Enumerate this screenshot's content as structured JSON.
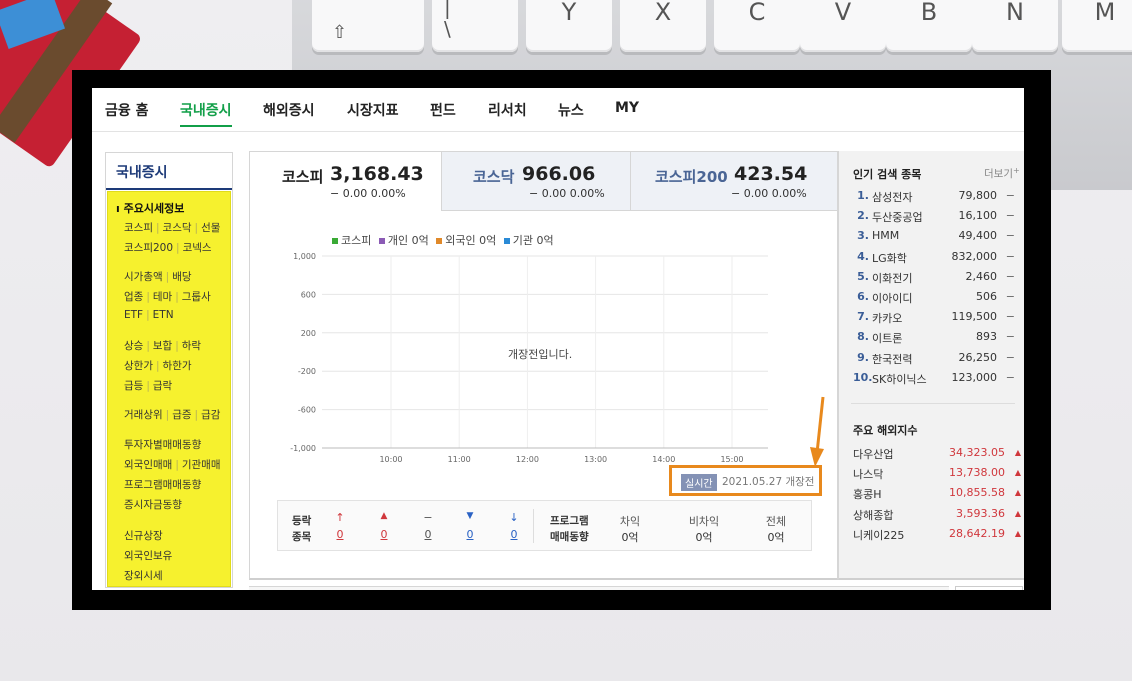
{
  "nav": {
    "tabs": [
      {
        "label": "금융 홈"
      },
      {
        "label": "국내증시"
      },
      {
        "label": "해외증시"
      },
      {
        "label": "시장지표"
      },
      {
        "label": "펀드"
      },
      {
        "label": "리서치"
      },
      {
        "label": "뉴스"
      },
      {
        "label": "MY"
      }
    ],
    "active_tab": "국내증시"
  },
  "sidebar": {
    "title": "국내증시",
    "section_head": "주요시세정보",
    "rows": [
      [
        "코스피",
        "코스닥",
        "선물"
      ],
      [
        "코스피200",
        "코넥스"
      ],
      [
        "시가총액",
        "배당"
      ],
      [
        "업종",
        "테마",
        "그룹사"
      ],
      [
        "ETF",
        "ETN"
      ],
      [
        "상승",
        "보합",
        "하락"
      ],
      [
        "상한가",
        "하한가"
      ],
      [
        "급등",
        "급락"
      ],
      [
        "거래상위",
        "급증",
        "급감"
      ],
      [
        "투자자별매매동향"
      ],
      [
        "외국인매매",
        "기관매매"
      ],
      [
        "프로그램매매동향"
      ],
      [
        "증시자금동향"
      ],
      [
        "신규상장"
      ],
      [
        "외국인보유"
      ],
      [
        "장외시세"
      ]
    ]
  },
  "indices": [
    {
      "name": "코스피",
      "value": "3,168.43",
      "change": "− 0.00 0.00%"
    },
    {
      "name": "코스닥",
      "value": "966.06",
      "change": "− 0.00 0.00%"
    },
    {
      "name": "코스피200",
      "value": "423.54",
      "change": "− 0.00 0.00%"
    }
  ],
  "chart": {
    "legend": [
      {
        "label": "코스피",
        "color": "#3aaa35"
      },
      {
        "label": "개인 0억",
        "color": "#8b5bb5"
      },
      {
        "label": "외국인 0억",
        "color": "#e0892a"
      },
      {
        "label": "기관 0억",
        "color": "#2a8ad6"
      }
    ],
    "message": "개장전입니다.",
    "chart_data": {
      "type": "line",
      "ylim": [
        -1000,
        1000
      ],
      "y_ticks": [
        "1,000",
        "600",
        "200",
        "-200",
        "-600",
        "-1,000"
      ],
      "x_ticks": [
        "10:00",
        "11:00",
        "12:00",
        "13:00",
        "14:00",
        "15:00"
      ],
      "series": []
    },
    "realtime_badge": "실시간",
    "realtime_text": "2021.05.27  개장전"
  },
  "stats": {
    "label_top": "등락",
    "label_bottom": "종목",
    "icons": [
      "↑",
      "▲",
      "−",
      "▼",
      "↓"
    ],
    "values": [
      "0",
      "0",
      "0",
      "0",
      "0"
    ],
    "program_label_top": "프로그램",
    "program_label_bottom": "매매동향",
    "program_cols": [
      {
        "label": "차익",
        "value": "0억"
      },
      {
        "label": "비차익",
        "value": "0억"
      },
      {
        "label": "전체",
        "value": "0억"
      }
    ]
  },
  "popular": {
    "title": "인기 검색 종목",
    "more": "더보기",
    "items": [
      {
        "rank": "1.",
        "name": "삼성전자",
        "price": "79,800",
        "change": "−"
      },
      {
        "rank": "2.",
        "name": "두산중공업",
        "price": "16,100",
        "change": "−"
      },
      {
        "rank": "3.",
        "name": "HMM",
        "price": "49,400",
        "change": "−"
      },
      {
        "rank": "4.",
        "name": "LG화학",
        "price": "832,000",
        "change": "−"
      },
      {
        "rank": "5.",
        "name": "이화전기",
        "price": "2,460",
        "change": "−"
      },
      {
        "rank": "6.",
        "name": "이아이디",
        "price": "506",
        "change": "−"
      },
      {
        "rank": "7.",
        "name": "카카오",
        "price": "119,500",
        "change": "−"
      },
      {
        "rank": "8.",
        "name": "이트론",
        "price": "893",
        "change": "−"
      },
      {
        "rank": "9.",
        "name": "한국전력",
        "price": "26,250",
        "change": "−"
      },
      {
        "rank": "10.",
        "name": "SK하이닉스",
        "price": "123,000",
        "change": "−"
      }
    ]
  },
  "overseas": {
    "title": "주요 해외지수",
    "items": [
      {
        "name": "다우산업",
        "value": "34,323.05"
      },
      {
        "name": "나스닥",
        "value": "13,738.00"
      },
      {
        "name": "홍콩H",
        "value": "10,855.58"
      },
      {
        "name": "상해종합",
        "value": "3,593.36"
      },
      {
        "name": "니케이225",
        "value": "28,642.19"
      }
    ],
    "up_icon": "▲"
  },
  "keyboard": {
    "keys": [
      "⇧",
      "|",
      "\\",
      "Y",
      "X",
      "C",
      "V",
      "B",
      "N",
      "M"
    ]
  }
}
